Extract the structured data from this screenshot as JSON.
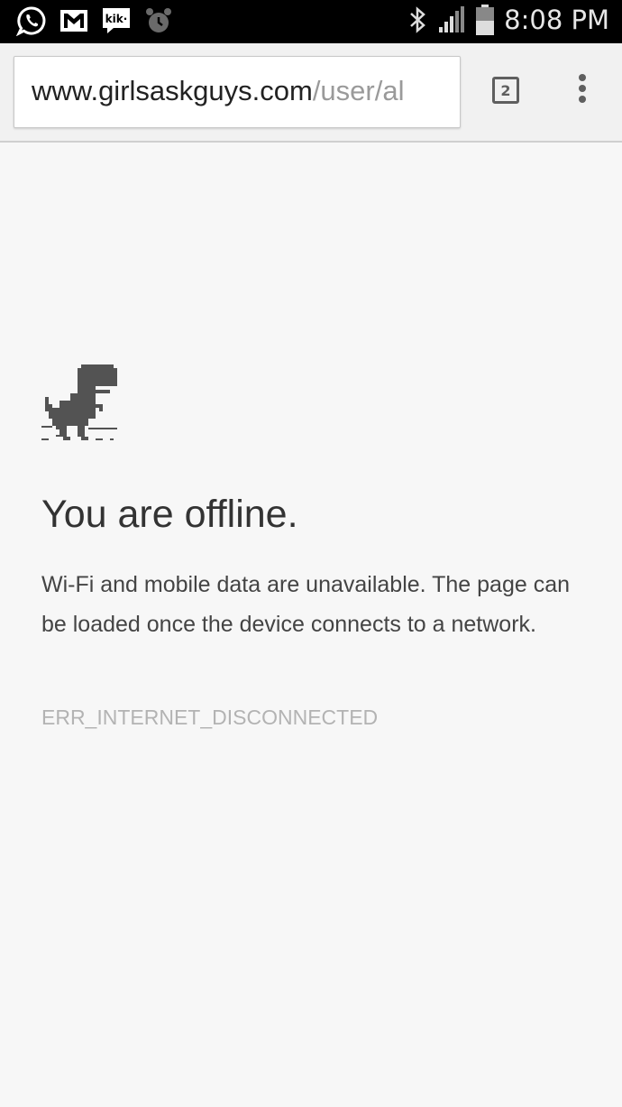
{
  "status_bar": {
    "time": "8:08 PM",
    "left_icons": [
      "whatsapp-icon",
      "gmail-icon",
      "kik-icon",
      "alarm-icon"
    ],
    "right_icons": [
      "bluetooth-icon",
      "signal-icon",
      "battery-icon"
    ]
  },
  "toolbar": {
    "url_domain": "www.girlsaskguys.com",
    "url_path": "/user/al",
    "tab_count": "2"
  },
  "page": {
    "title": "You are offline.",
    "description": "Wi-Fi and mobile data are unavailable. The page can be loaded once the device connects to a network.",
    "error_code": "ERR_INTERNET_DISCONNECTED"
  },
  "colors": {
    "background": "#f7f7f7",
    "status_bar": "#000000",
    "title_text": "#333333",
    "error_text": "#b3b3b3",
    "dino": "#535353"
  }
}
